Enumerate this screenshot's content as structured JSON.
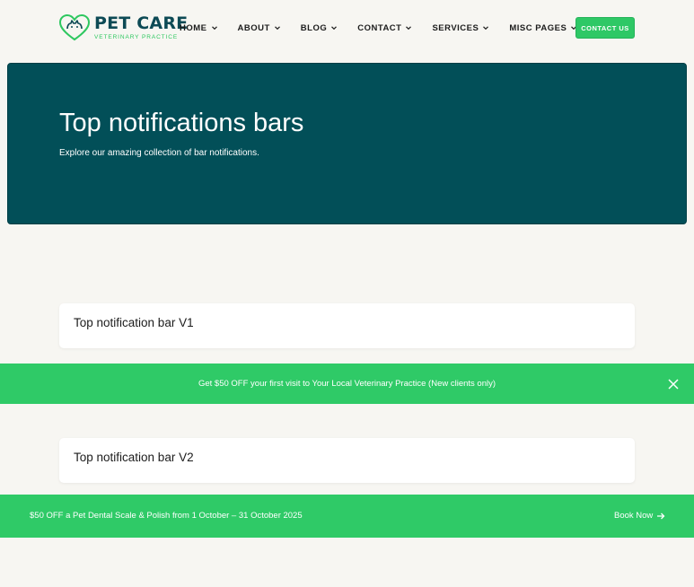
{
  "header": {
    "logo": {
      "title": "PET CARE",
      "subtitle": "VETERINARY PRACTICE",
      "icon": "pet-heart-logo-icon"
    },
    "nav": [
      {
        "label": "HOME",
        "icon": "chevron-down-icon"
      },
      {
        "label": "ABOUT",
        "icon": "chevron-down-icon"
      },
      {
        "label": "BLOG",
        "icon": "chevron-down-icon"
      },
      {
        "label": "CONTACT",
        "icon": "chevron-down-icon"
      },
      {
        "label": "SERVICES",
        "icon": "chevron-down-icon"
      },
      {
        "label": "MISC PAGES",
        "icon": "chevron-down-icon"
      }
    ],
    "cta_label": "CONTACT US"
  },
  "hero": {
    "title": "Top notifications bars",
    "subtitle": "Explore our amazing collection of bar notifications."
  },
  "sections": [
    {
      "card_title": "Top notification bar V1",
      "bar_text": "Get $50 OFF your first visit to Your Local Veterinary Practice (New clients only)",
      "close_icon": "close-icon"
    },
    {
      "card_title": "Top notification bar V2",
      "bar_text": "$50 OFF a Pet Dental Scale & Polish  from 1 October – 31 October 2025",
      "link_label": "Book Now",
      "link_icon": "arrow-right-icon"
    }
  ],
  "colors": {
    "brand_dark": "#024f58",
    "accent_green": "#2fca67",
    "background": "#f7f6f2"
  }
}
